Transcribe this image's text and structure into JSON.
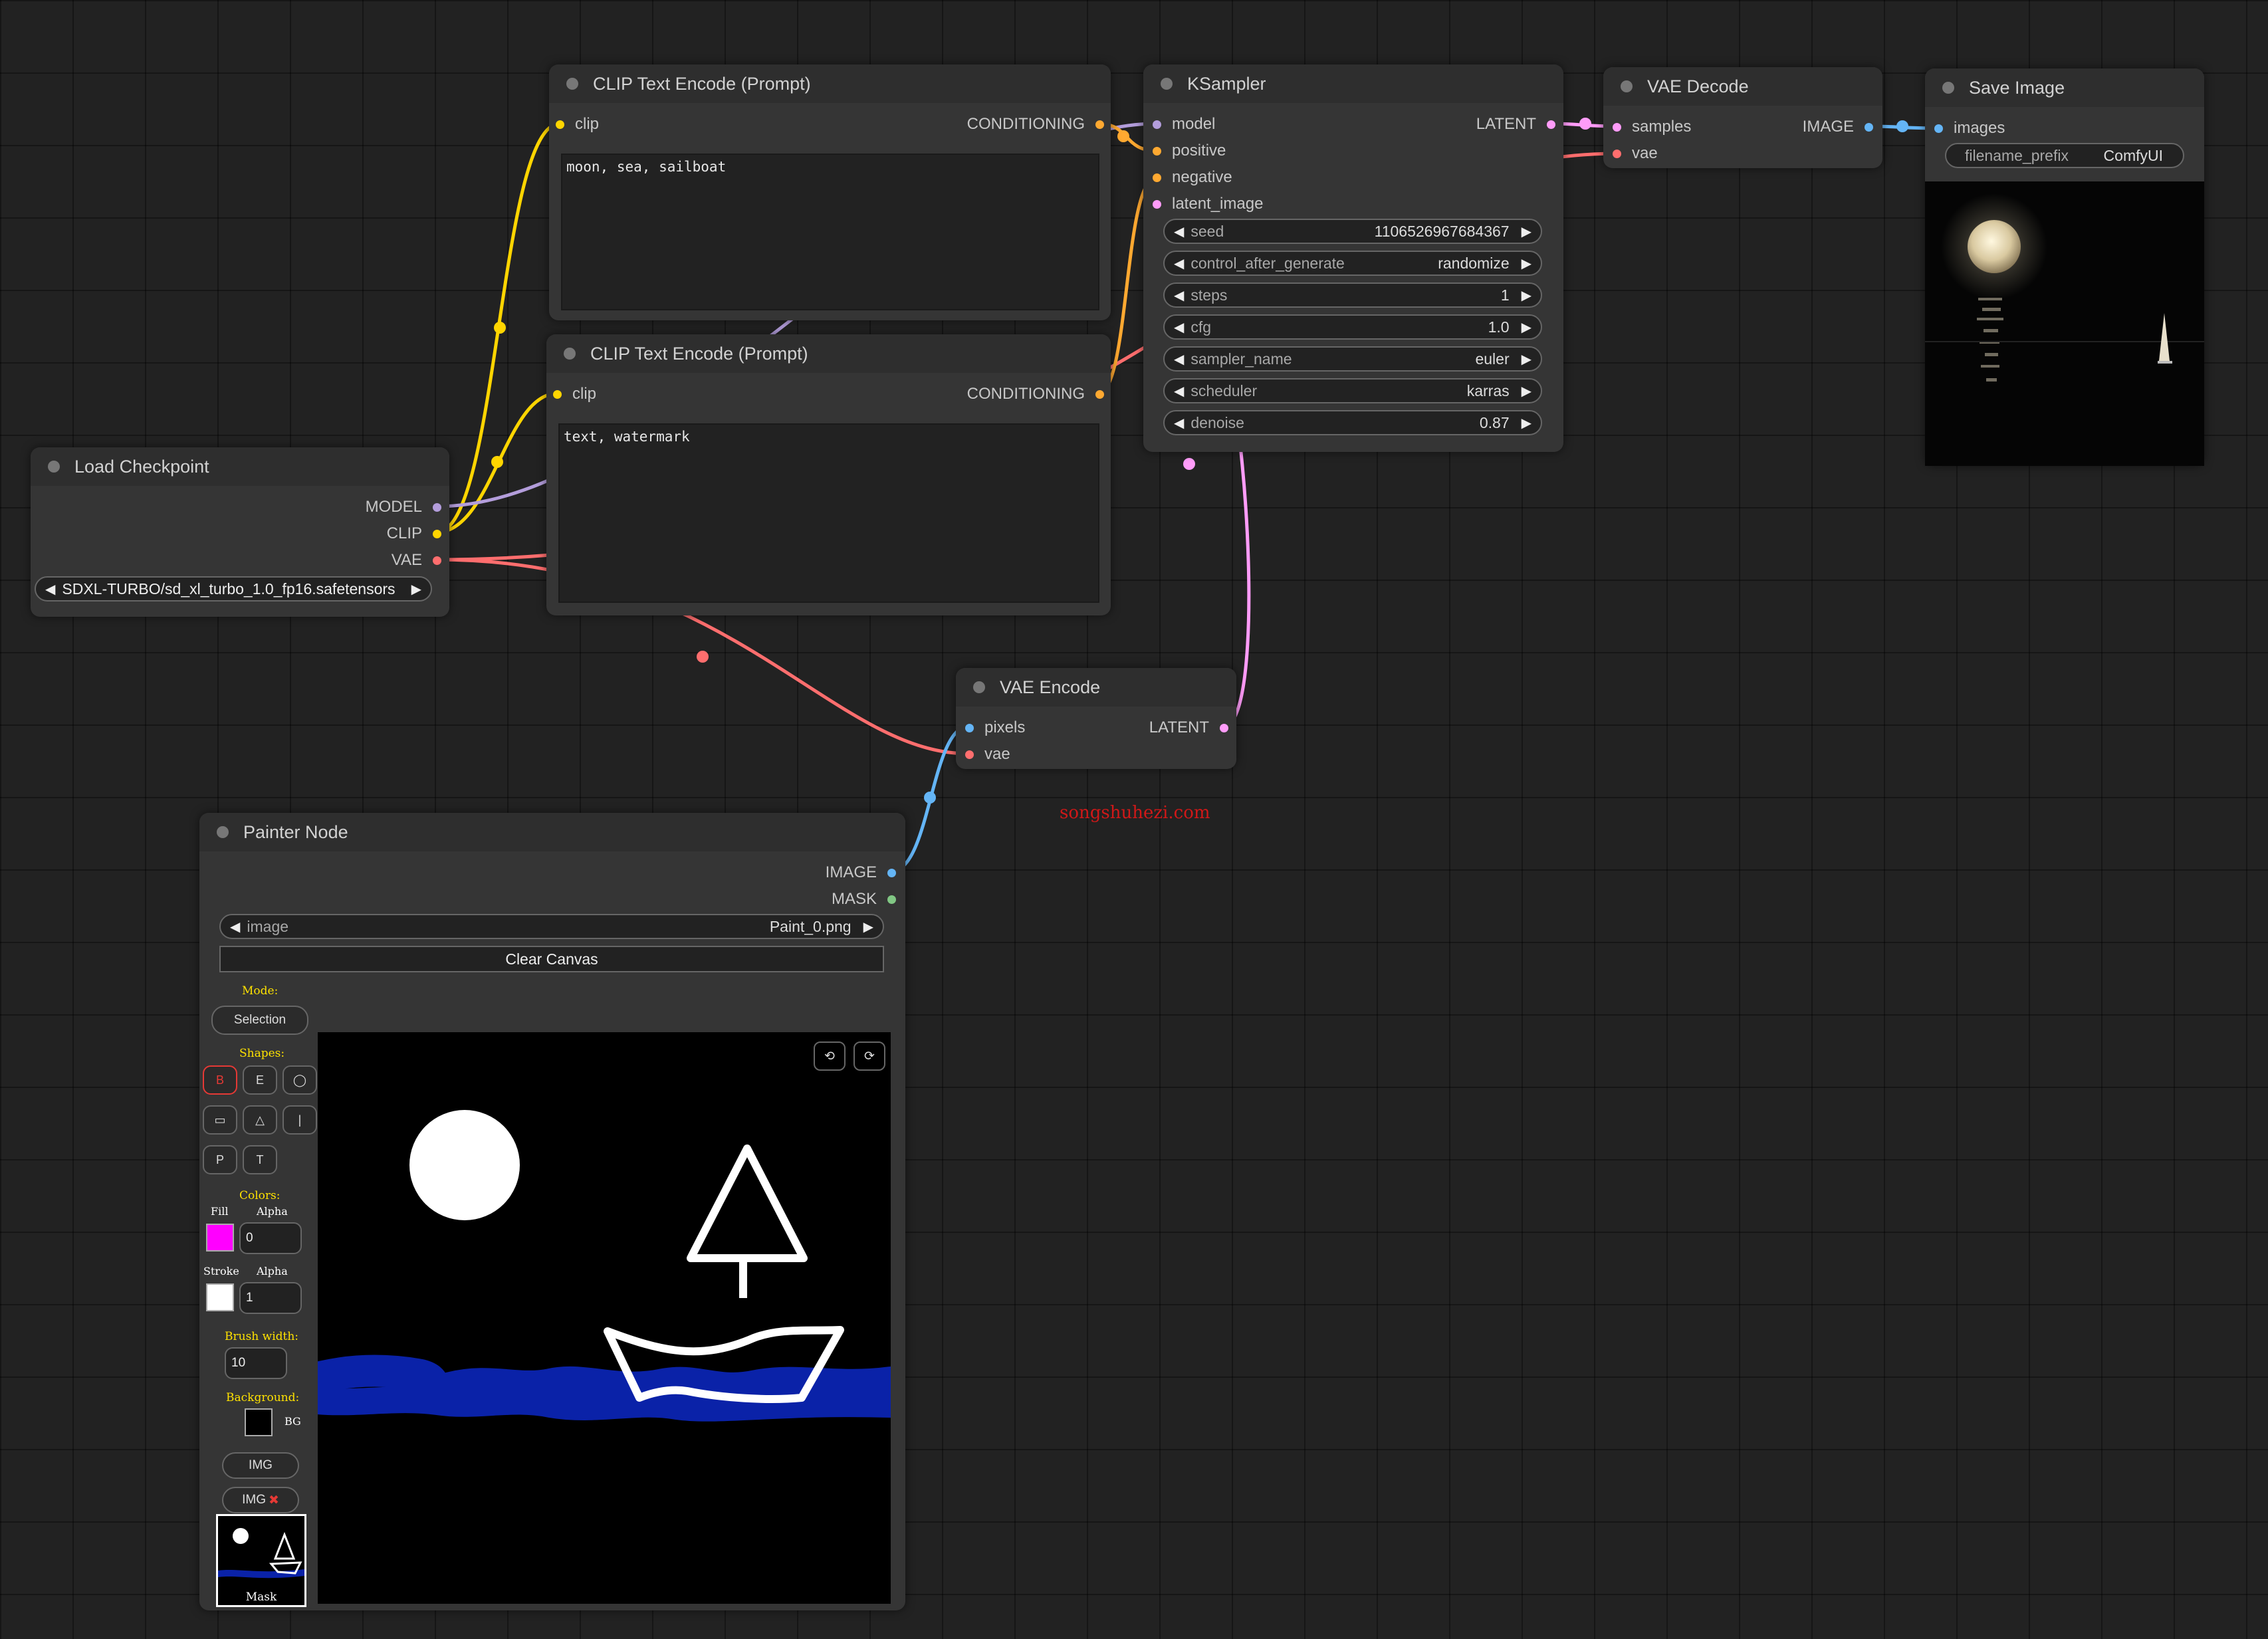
{
  "watermark": "songshuhezi.com",
  "colors": {
    "model": "#b39ddb",
    "clip": "#ffd500",
    "vae": "#ff6e6e",
    "conditioning": "#ffa931",
    "latent": "#ff9cf9",
    "image": "#64b5f6",
    "mask": "#81c784"
  },
  "clip_pos": {
    "title": "CLIP Text Encode (Prompt)",
    "in_clip": "clip",
    "out_cond": "CONDITIONING",
    "text": "moon, sea, sailboat"
  },
  "clip_neg": {
    "title": "CLIP Text Encode (Prompt)",
    "in_clip": "clip",
    "out_cond": "CONDITIONING",
    "text": "text, watermark"
  },
  "ksampler": {
    "title": "KSampler",
    "inputs": [
      "model",
      "positive",
      "negative",
      "latent_image"
    ],
    "out_latent": "LATENT",
    "widgets": [
      {
        "label": "seed",
        "value": "1106526967684367"
      },
      {
        "label": "control_after_generate",
        "value": "randomize"
      },
      {
        "label": "steps",
        "value": "1"
      },
      {
        "label": "cfg",
        "value": "1.0"
      },
      {
        "label": "sampler_name",
        "value": "euler"
      },
      {
        "label": "scheduler",
        "value": "karras"
      },
      {
        "label": "denoise",
        "value": "0.87"
      }
    ]
  },
  "vae_decode": {
    "title": "VAE Decode",
    "in_samples": "samples",
    "in_vae": "vae",
    "out_image": "IMAGE"
  },
  "save_image": {
    "title": "Save Image",
    "in_images": "images",
    "prefix_label": "filename_prefix",
    "prefix_value": "ComfyUI"
  },
  "load_ckpt": {
    "title": "Load Checkpoint",
    "out_model": "MODEL",
    "out_clip": "CLIP",
    "out_vae": "VAE",
    "ckpt_label": "SDXL-TURBO/sd_xl_turbo_1.0_fp16.safetensors"
  },
  "vae_encode": {
    "title": "VAE Encode",
    "in_pixels": "pixels",
    "in_vae": "vae",
    "out_latent": "LATENT"
  },
  "painter": {
    "title": "Painter Node",
    "out_image": "IMAGE",
    "out_mask": "MASK",
    "image_label": "image",
    "image_value": "Paint_0.png",
    "clear_label": "Clear Canvas",
    "mode_label": "Mode:",
    "mode_value": "Selection",
    "shapes_label": "Shapes:",
    "shape_buttons": [
      "B",
      "E",
      "◯",
      "▭",
      "△",
      "|",
      "P",
      "T"
    ],
    "colors_label": "Colors:",
    "fill_label": "Fill",
    "alpha_label": "Alpha",
    "fill_color": "#ff00ff",
    "fill_alpha": "0",
    "stroke_label": "Stroke",
    "stroke_color": "#ffffff",
    "stroke_alpha": "1",
    "brush_label": "Brush width:",
    "brush_value": "10",
    "bg_label": "Background:",
    "bg_short": "BG",
    "bg_color": "#000000",
    "img_btn": "IMG",
    "img_remove_btn": "IMG",
    "mask_label": "Mask",
    "canvas_undo": "⟲",
    "canvas_redo": "⟳"
  }
}
